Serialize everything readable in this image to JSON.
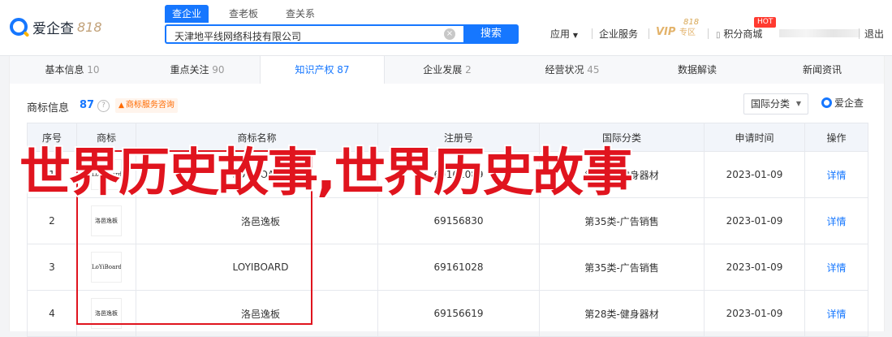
{
  "header": {
    "logo_text": "爱企查",
    "logo_818": "818",
    "search_tabs": [
      "查企业",
      "查老板",
      "查关系"
    ],
    "search_value": "天津地平线网络科技有限公司",
    "search_button": "搜索",
    "nav": {
      "apply": "应用",
      "enterprise_service": "企业服务",
      "vip_text": "VIP",
      "vip_sub": "专区",
      "vip_818": "818",
      "hot_badge": "HOT",
      "points_mall": "积分商城",
      "logout": "退出"
    }
  },
  "tabs": [
    {
      "label": "基本信息",
      "count": "10"
    },
    {
      "label": "重点关注",
      "count": "90"
    },
    {
      "label": "知识产权",
      "count": "87"
    },
    {
      "label": "企业发展",
      "count": "2"
    },
    {
      "label": "经营状况",
      "count": "45"
    },
    {
      "label": "数据解读",
      "count": ""
    },
    {
      "label": "新闻资讯",
      "count": ""
    }
  ],
  "section": {
    "title": "商标信息",
    "count": "87",
    "help": "?",
    "consult": "商标服务咨询",
    "filter_label": "国际分类",
    "watermark": "爱企查"
  },
  "table": {
    "columns": [
      "序号",
      "商标",
      "商标名称",
      "注册号",
      "国际分类",
      "申请时间",
      "操作"
    ],
    "rows": [
      {
        "idx": "1",
        "thumb": "LoYiBoard",
        "name": "LOYIBOARD",
        "reg": "69161089",
        "cls": "第28类-健身器材",
        "date": "2023-01-09",
        "op": "详情"
      },
      {
        "idx": "2",
        "thumb": "洛邑逸板",
        "name": "洛邑逸板",
        "reg": "69156830",
        "cls": "第35类-广告销售",
        "date": "2023-01-09",
        "op": "详情"
      },
      {
        "idx": "3",
        "thumb": "LoYiBoard",
        "name": "LOYIBOARD",
        "reg": "69161028",
        "cls": "第35类-广告销售",
        "date": "2023-01-09",
        "op": "详情"
      },
      {
        "idx": "4",
        "thumb": "洛邑逸板",
        "name": "洛邑逸板",
        "reg": "69156619",
        "cls": "第28类-健身器材",
        "date": "2023-01-09",
        "op": "详情"
      }
    ]
  },
  "overlay_text": "世界历史故事,世界历史故事",
  "colors": {
    "accent": "#1677ff",
    "overlay_red": "#e0141e",
    "consult_orange": "#ff6a00"
  }
}
